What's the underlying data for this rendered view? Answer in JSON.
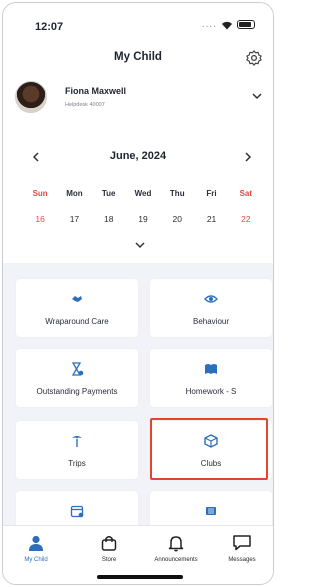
{
  "status_bar": {
    "time": "12:07",
    "dots": "...."
  },
  "header": {
    "title": "My Child",
    "settings_icon": "gear-icon"
  },
  "profile": {
    "name": "Fiona Maxwell",
    "subtitle": "Helpdesk 40007"
  },
  "calendar": {
    "month": "June, 2024",
    "weekdays": [
      "Sun",
      "Mon",
      "Tue",
      "Wed",
      "Thu",
      "Fri",
      "Sat"
    ],
    "dates": [
      "16",
      "17",
      "18",
      "19",
      "20",
      "21",
      "22"
    ]
  },
  "tiles": [
    {
      "label": "Wraparound Care",
      "icon": "handshake-icon"
    },
    {
      "label": "Behaviour",
      "icon": "eye-icon"
    },
    {
      "label": "Outstanding Payments",
      "icon": "hourglass-icon"
    },
    {
      "label": "Homework - S",
      "icon": "book-icon"
    },
    {
      "label": "Trips",
      "icon": "palm-tree-icon"
    },
    {
      "label": "Clubs",
      "icon": "box-icon"
    },
    {
      "label": "",
      "icon": "calendar-icon"
    },
    {
      "label": "",
      "icon": "menu-icon"
    }
  ],
  "tabbar": [
    {
      "label": "My Child",
      "icon": "person-icon",
      "active": true
    },
    {
      "label": "Store",
      "icon": "shopping-bag-icon",
      "active": false
    },
    {
      "label": "Announcements",
      "icon": "bell-icon",
      "active": false
    },
    {
      "label": "Messages",
      "icon": "chat-icon",
      "active": false
    }
  ],
  "colors": {
    "accent": "#2c6fbd",
    "weekend": "#e2464a",
    "highlight": "#e0452e"
  }
}
